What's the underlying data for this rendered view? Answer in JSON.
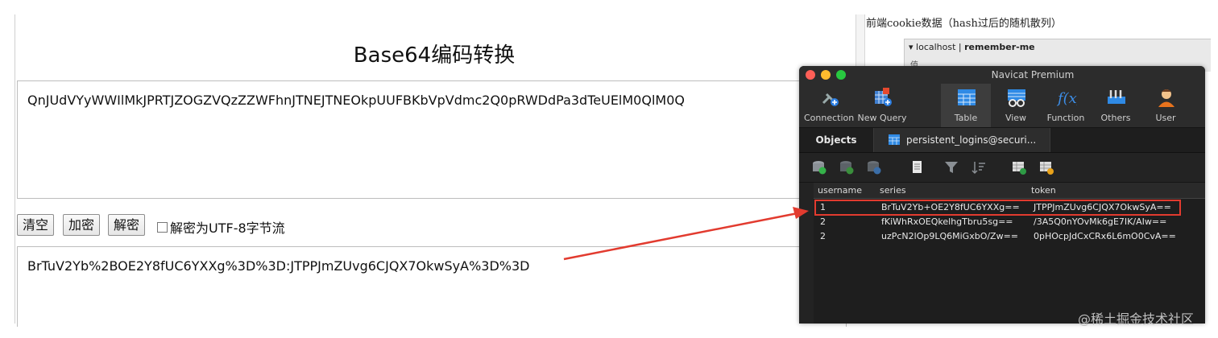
{
  "converter": {
    "title": "Base64编码转换",
    "input_text": "QnJUdVYyWWIlMkJPRTJZOGZVQzZZWFhnJTNEJTNEOkpUUFBKbVpVdmc2Q0pRWDdPa3dTeUElM0QlM0Q",
    "buttons": {
      "clear": "清空",
      "encode": "加密",
      "decode": "解密"
    },
    "checkbox_label": "解密为UTF-8字节流",
    "output_text": "BrTuV2Yb%2BOE2Y8fUC6YXXg%3D%3D:JTPPJmZUvg6CJQX7OkwSyA%3D%3D"
  },
  "background": {
    "note": "前端cookie数据（hash过后的随机散列）",
    "window_label_prefix": "localhost | ",
    "window_label_bold": "remember-me",
    "mini": "值"
  },
  "navicat": {
    "title": "Navicat Premium",
    "toolbar": [
      {
        "label": "Connection",
        "icon": "connection-icon"
      },
      {
        "label": "New Query",
        "icon": "new-query-icon"
      },
      {
        "label": "Table",
        "icon": "table-icon"
      },
      {
        "label": "View",
        "icon": "view-icon"
      },
      {
        "label": "Function",
        "icon": "function-icon"
      },
      {
        "label": "Others",
        "icon": "others-icon"
      },
      {
        "label": "User",
        "icon": "user-icon"
      }
    ],
    "tabs": {
      "objects": "Objects",
      "table_tab": "persistent_logins@securi..."
    },
    "columns": [
      "username",
      "series",
      "token"
    ],
    "rows": [
      {
        "username": "1",
        "series": "BrTuV2Yb+OE2Y8fUC6YXXg==",
        "token": "JTPPJmZUvg6CJQX7OkwSyA=="
      },
      {
        "username": "2",
        "series": "fKiWhRxOEQkelhgTbru5sg==",
        "token": "/3A5Q0nYOvMk6gE7IK/AIw=="
      },
      {
        "username": "2",
        "series": "uzPcN2lOp9LQ6MiGxbO/Zw==",
        "token": "0pHOcpJdCxCRx6L6mO0CvA=="
      }
    ]
  },
  "watermark": "@稀土掘金技术社区",
  "colors": {
    "highlight": "#e23b2f",
    "arrow": "#e23b2f",
    "navicat_bg": "#232323"
  }
}
